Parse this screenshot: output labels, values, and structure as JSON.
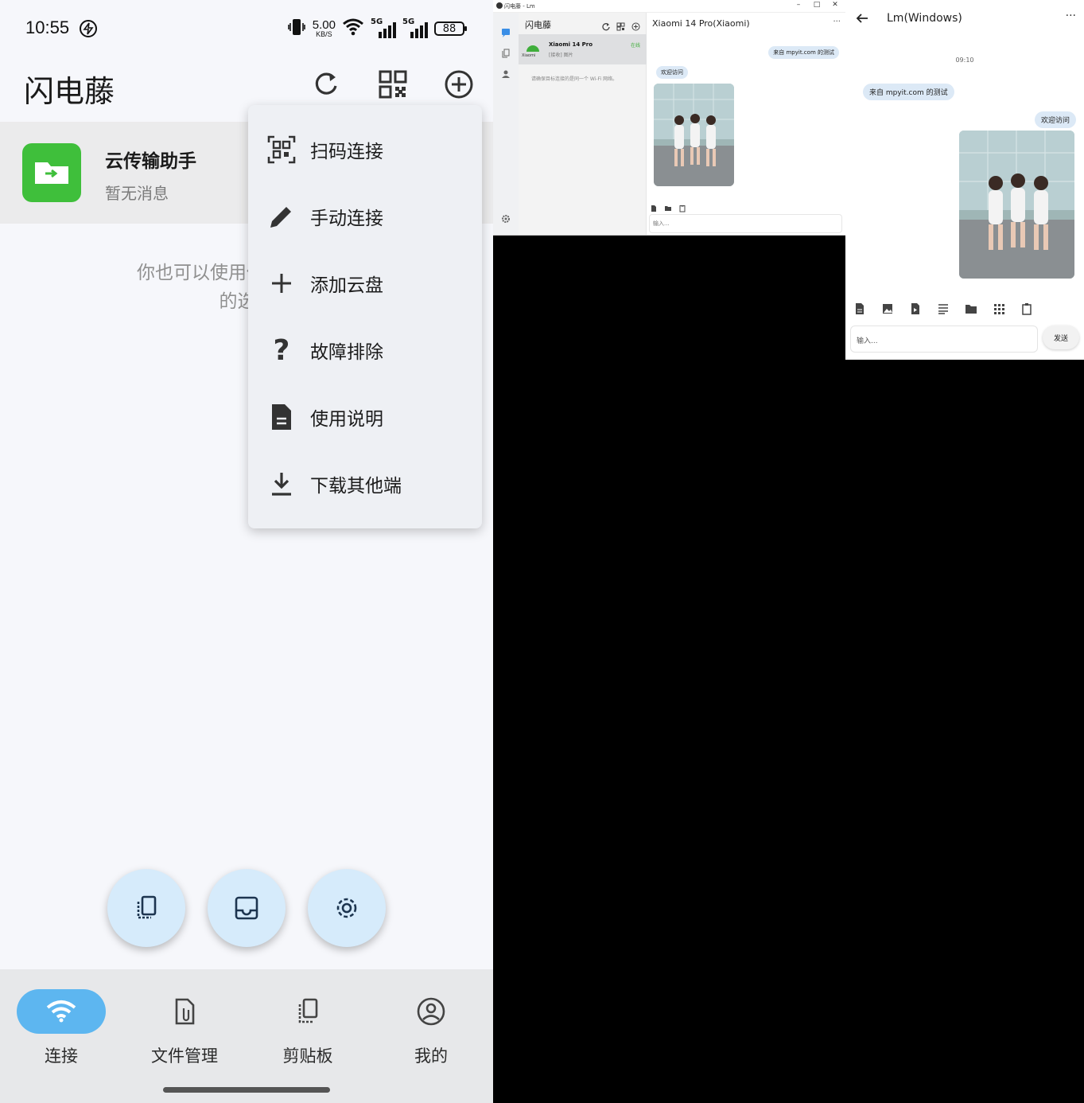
{
  "phone": {
    "status": {
      "time": "10:55",
      "speed_value": "5.00",
      "speed_unit": "KB/S",
      "net1": "5G",
      "net2": "5G",
      "battery": "88"
    },
    "app_title": "闪电藤",
    "conversation": {
      "name": "云传输助手",
      "preview": "暂无消息"
    },
    "hint_line1": "你也可以使用你的移动设备",
    "hint_line2": "的选择",
    "menu": [
      {
        "label": "扫码连接",
        "icon": "qr-scan-icon"
      },
      {
        "label": "手动连接",
        "icon": "pencil-icon"
      },
      {
        "label": "添加云盘",
        "icon": "plus-icon"
      },
      {
        "label": "故障排除",
        "icon": "question-icon"
      },
      {
        "label": "使用说明",
        "icon": "document-icon"
      },
      {
        "label": "下载其他端",
        "icon": "download-icon"
      }
    ],
    "nav": [
      {
        "label": "连接",
        "icon": "wifi-icon",
        "active": true
      },
      {
        "label": "文件管理",
        "icon": "file-clip-icon",
        "active": false
      },
      {
        "label": "剪贴板",
        "icon": "clipboard-icon",
        "active": false
      },
      {
        "label": "我的",
        "icon": "account-icon",
        "active": false
      }
    ],
    "accent": "#5db6f0"
  },
  "desktop": {
    "window_title": "闪电藤 - Lm",
    "controls": [
      "–",
      "□",
      "✕"
    ],
    "list_title": "闪电藤",
    "device": {
      "name": "Xiaomi 14 Pro",
      "vendor": "Xiaomi",
      "last": "[接收] 图片",
      "status": "在线"
    },
    "wifi_note": "请确保目标连接的是同一个 Wi-Fi 网络。",
    "chat_title": "Xiaomi 14 Pro(Xiaomi)",
    "more": "···",
    "msg_right": "来自 mpyit.com 的测试",
    "msg_left": "欢迎访问",
    "input_placeholder": "输入..."
  },
  "mobile_chat": {
    "title": "Lm(Windows)",
    "more": "···",
    "time": "09:10",
    "msg_left": "来自 mpyit.com 的测试",
    "msg_right": "欢迎访问",
    "input_placeholder": "输入...",
    "send": "发送"
  }
}
